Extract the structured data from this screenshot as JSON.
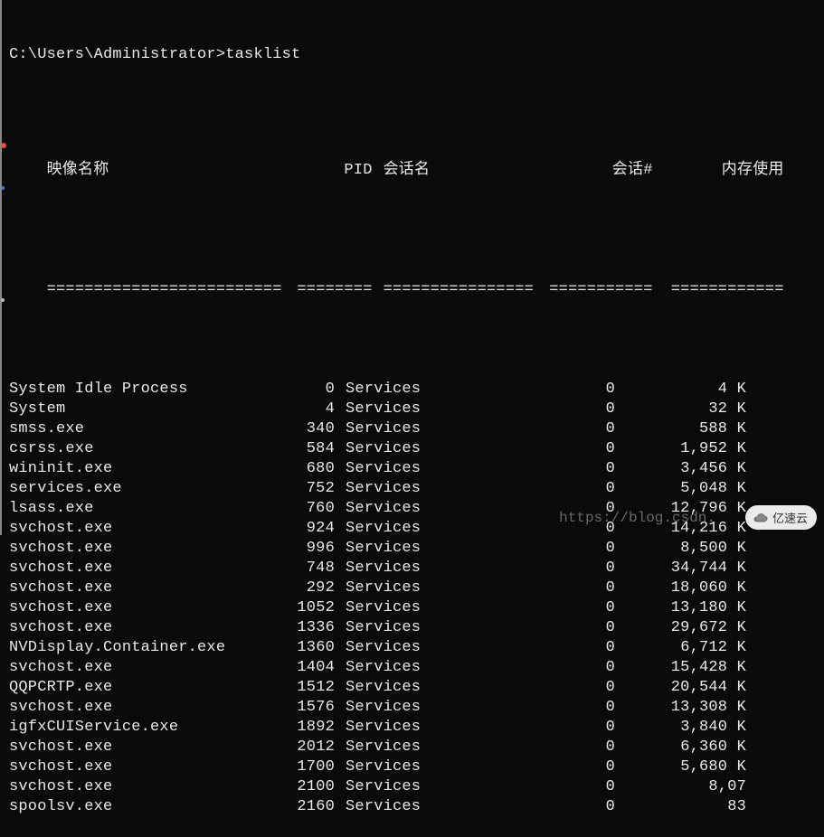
{
  "prompt": "C:\\Users\\Administrator>tasklist",
  "headers": {
    "name": "映像名称",
    "pid": "PID",
    "session": "会话名",
    "sessnum": "会话#",
    "mem": "内存使用"
  },
  "divider": {
    "name": "=========================",
    "pid": "========",
    "session": "================",
    "sessnum": "===========",
    "mem": "============"
  },
  "processes": [
    {
      "name": "System Idle Process",
      "pid": "0",
      "session": "Services",
      "sessnum": "0",
      "mem": "4 K"
    },
    {
      "name": "System",
      "pid": "4",
      "session": "Services",
      "sessnum": "0",
      "mem": "32 K"
    },
    {
      "name": "smss.exe",
      "pid": "340",
      "session": "Services",
      "sessnum": "0",
      "mem": "588 K"
    },
    {
      "name": "csrss.exe",
      "pid": "584",
      "session": "Services",
      "sessnum": "0",
      "mem": "1,952 K"
    },
    {
      "name": "wininit.exe",
      "pid": "680",
      "session": "Services",
      "sessnum": "0",
      "mem": "3,456 K"
    },
    {
      "name": "services.exe",
      "pid": "752",
      "session": "Services",
      "sessnum": "0",
      "mem": "5,048 K"
    },
    {
      "name": "lsass.exe",
      "pid": "760",
      "session": "Services",
      "sessnum": "0",
      "mem": "12,796 K"
    },
    {
      "name": "svchost.exe",
      "pid": "924",
      "session": "Services",
      "sessnum": "0",
      "mem": "14,216 K"
    },
    {
      "name": "svchost.exe",
      "pid": "996",
      "session": "Services",
      "sessnum": "0",
      "mem": "8,500 K"
    },
    {
      "name": "svchost.exe",
      "pid": "748",
      "session": "Services",
      "sessnum": "0",
      "mem": "34,744 K"
    },
    {
      "name": "svchost.exe",
      "pid": "292",
      "session": "Services",
      "sessnum": "0",
      "mem": "18,060 K"
    },
    {
      "name": "svchost.exe",
      "pid": "1052",
      "session": "Services",
      "sessnum": "0",
      "mem": "13,180 K"
    },
    {
      "name": "svchost.exe",
      "pid": "1336",
      "session": "Services",
      "sessnum": "0",
      "mem": "29,672 K"
    },
    {
      "name": "NVDisplay.Container.exe",
      "pid": "1360",
      "session": "Services",
      "sessnum": "0",
      "mem": "6,712 K"
    },
    {
      "name": "svchost.exe",
      "pid": "1404",
      "session": "Services",
      "sessnum": "0",
      "mem": "15,428 K"
    },
    {
      "name": "QQPCRTP.exe",
      "pid": "1512",
      "session": "Services",
      "sessnum": "0",
      "mem": "20,544 K"
    },
    {
      "name": "svchost.exe",
      "pid": "1576",
      "session": "Services",
      "sessnum": "0",
      "mem": "13,308 K"
    },
    {
      "name": "igfxCUIService.exe",
      "pid": "1892",
      "session": "Services",
      "sessnum": "0",
      "mem": "3,840 K"
    },
    {
      "name": "svchost.exe",
      "pid": "2012",
      "session": "Services",
      "sessnum": "0",
      "mem": "6,360 K"
    },
    {
      "name": "svchost.exe",
      "pid": "1700",
      "session": "Services",
      "sessnum": "0",
      "mem": "5,680 K"
    },
    {
      "name": "svchost.exe",
      "pid": "2100",
      "session": "Services",
      "sessnum": "0",
      "mem": "8,07"
    },
    {
      "name": "spoolsv.exe",
      "pid": "2160",
      "session": "Services",
      "sessnum": "0",
      "mem": "83"
    }
  ],
  "watermark_url": "https://blog.csdn.",
  "watermark_logo_text": "亿速云"
}
